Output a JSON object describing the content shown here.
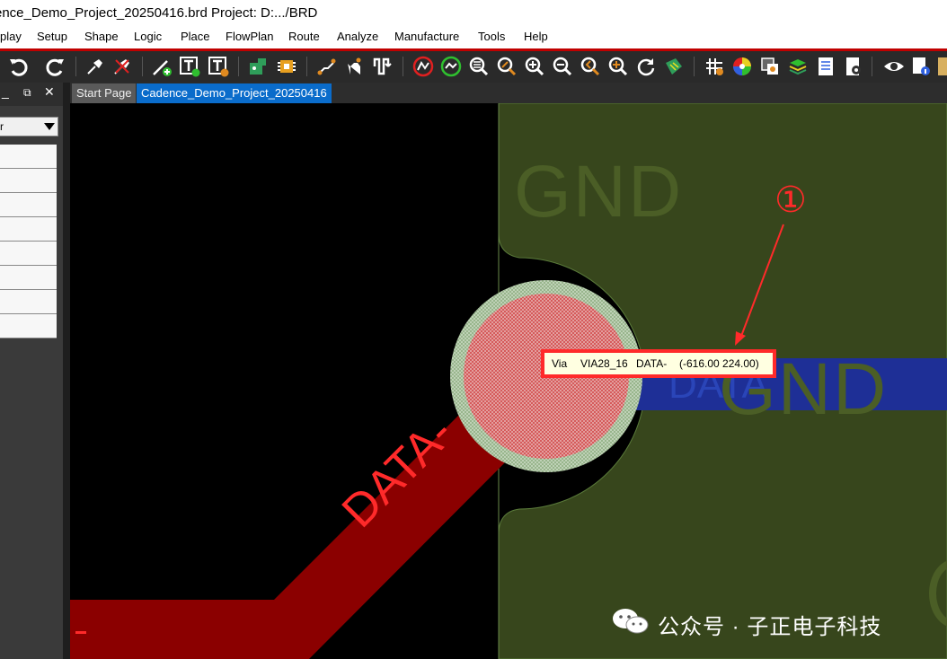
{
  "window": {
    "title": "ence_Demo_Project_20250416.brd  Project: D:.../BRD"
  },
  "menu": [
    "play",
    "Setup",
    "Shape",
    "Logic",
    "Place",
    "FlowPlan",
    "Route",
    "Analyze",
    "Manufacture",
    "Tools",
    "Help"
  ],
  "toolbar": {
    "icons": [
      "undo-icon",
      "redo-icon",
      "pin-icon",
      "unpin-icon",
      "add-connect-icon",
      "add-text-icon",
      "change-text-icon",
      "pcb-icon",
      "component-icon",
      "route-icon",
      "slide-icon",
      "delay-tune-icon",
      "drc-icon",
      "zoom-world-icon",
      "zoom-fit-icon",
      "zoom-in-icon",
      "zoom-out-icon",
      "zoom-prev-icon",
      "zoom-center-icon",
      "redraw-icon",
      "board-icon",
      "grid-icon",
      "color-icon",
      "shadow-icon",
      "layers-icon",
      "report-icon",
      "settings-icon",
      "visibility-icon",
      "info-icon"
    ]
  },
  "tabs": [
    {
      "label": "Start Page",
      "active": false
    },
    {
      "label": "Cadence_Demo_Project_20250416",
      "active": true
    }
  ],
  "panel": {
    "combo_value": "r",
    "rows": 8
  },
  "canvas": {
    "labels": {
      "gnd_top": "GND",
      "gnd_right": "GND",
      "data_trace": "DATA-",
      "data_trace_right": "DATA",
      "annotation": "①"
    },
    "colors": {
      "plane": "#37461c",
      "plane_text": "#4b5e26",
      "trace_red": "#8b0000",
      "trace_blue": "#1e2f96",
      "via_ring": "#b8d0b0",
      "via_pad": "#d86060",
      "callout": "#ff2a2a"
    }
  },
  "tooltip": {
    "type": "Via",
    "padstack": "VIA28_16",
    "net": "DATA-",
    "coords": "(-616.00 224.00)"
  },
  "watermark": {
    "text": "公众号 · 子正电子科技"
  }
}
